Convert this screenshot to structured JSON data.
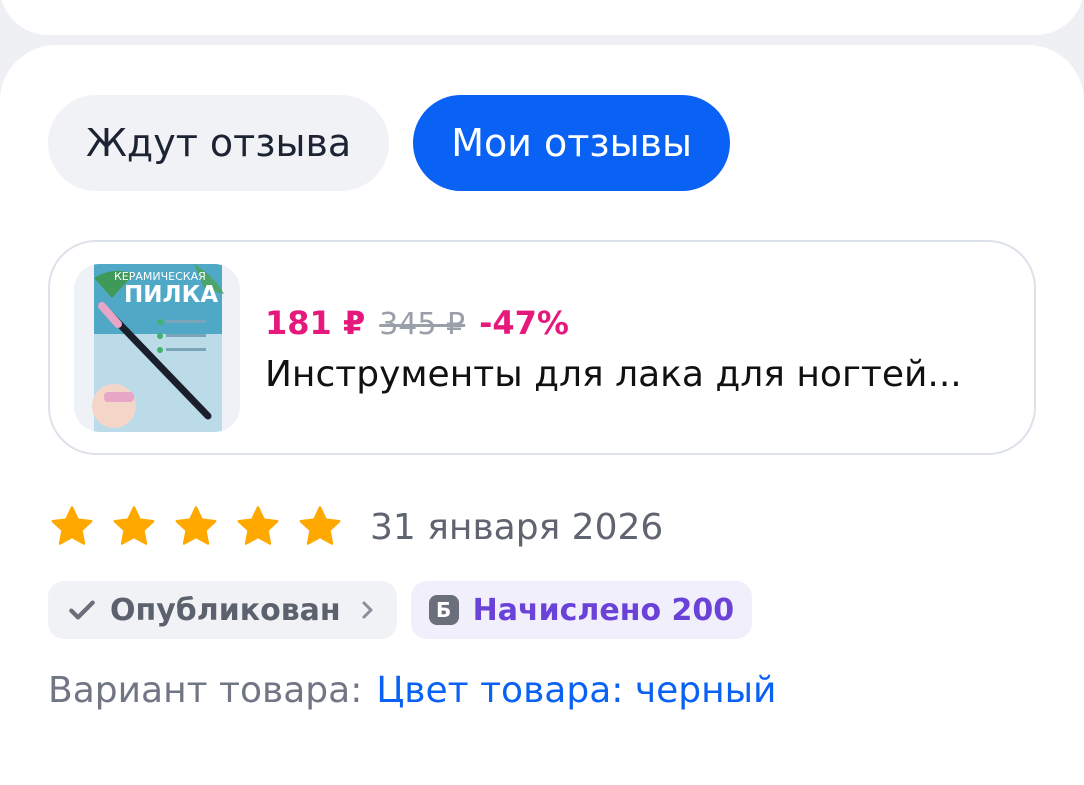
{
  "tabs": [
    {
      "label": "Ждут отзыва",
      "active": false
    },
    {
      "label": "Мои отзывы",
      "active": true
    }
  ],
  "product": {
    "price_now": "181 ₽",
    "price_old": "345 ₽",
    "discount": "-47%",
    "title": "Инструменты для лака для ногтей...",
    "thumbnail_text": {
      "line1": "КЕРАМИЧЕСКАЯ",
      "line2": "ПИЛКА"
    }
  },
  "review": {
    "rating": 5,
    "rating_max": 5,
    "date": "31 января 2026",
    "status_label": "Опубликован",
    "bonus_icon": "Б",
    "bonus_label": "Начислено 200"
  },
  "variant": {
    "label": "Вариант товара:",
    "value": "Цвет товара: черный"
  },
  "colors": {
    "accent": "#0a62f5",
    "price": "#e5197b",
    "star": "#ffa800",
    "bonus": "#6a42d8"
  }
}
